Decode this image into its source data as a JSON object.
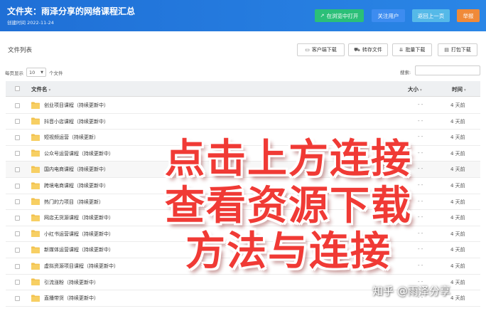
{
  "header": {
    "title": "文件夹：雨泽分享的网络课程汇总",
    "created": "创建时间 2022-11-24",
    "buttons": {
      "open_in_browser": "在浏览中打开",
      "follow_user": "关注用户",
      "back": "返回上一页",
      "report": "举报"
    }
  },
  "toolbar": {
    "title": "文件列表",
    "client_download": "客户端下载",
    "save": "转存文件",
    "batch_download": "批量下载",
    "pack_download": "打包下载"
  },
  "list_controls": {
    "per_page_label": "每页显示",
    "per_page_value": "10",
    "per_page_unit": "个文件",
    "search_label": "搜索:"
  },
  "table": {
    "columns": {
      "name": "文件名",
      "size": "大小",
      "time": "时间"
    },
    "rows": [
      {
        "name": "创业项目课程（持续更新中）",
        "size": "- -",
        "time": "4 天前"
      },
      {
        "name": "抖音小店课程（持续更新中）",
        "size": "- -",
        "time": "4 天前"
      },
      {
        "name": "短视频运营（持续更新）",
        "size": "- -",
        "time": "4 天前"
      },
      {
        "name": "公众号运营课程（持续更新中）",
        "size": "- -",
        "time": "4 天前"
      },
      {
        "name": "国内电商课程（持续更新中）",
        "size": "- -",
        "time": "4 天前"
      },
      {
        "name": "跨境电商课程（持续更新中）",
        "size": "- -",
        "time": "4 天前"
      },
      {
        "name": "热门的力项目（持续更新）",
        "size": "- -",
        "time": "4 天前"
      },
      {
        "name": "网店无货源课程（持续更新中）",
        "size": "- -",
        "time": "4 天前"
      },
      {
        "name": "小红书运营课程（持续更新中）",
        "size": "- -",
        "time": "4 天前"
      },
      {
        "name": "新媒体运营课程（持续更新中）",
        "size": "- -",
        "time": "4 天前"
      },
      {
        "name": "虚拟资源项目课程（持续更新中）",
        "size": "- -",
        "time": "4 天前"
      },
      {
        "name": "引流涨粉（持续更新中）",
        "size": "- -",
        "time": "4 天前"
      },
      {
        "name": "直播带货（持续更新中）",
        "size": "- -",
        "time": "4 天前"
      }
    ]
  },
  "overlay": {
    "line1": "点击上方连接",
    "line2": "查看资源下载",
    "line3": "方法与连接"
  },
  "watermark": "知乎 @雨泽分享",
  "colors": {
    "header_bg": "#1f6fd6",
    "open_button": "#2bbf78",
    "follow_button": "#3d8cf0",
    "back_button": "#55b9e8",
    "report_button": "#f08a39",
    "folder": "#f2c24f",
    "overlay_text": "#f03a35"
  },
  "icons": {
    "open": "external-link-icon",
    "client": "monitor-icon",
    "save": "car-transfer-icon",
    "batch": "batch-download-icon",
    "pack": "archive-icon",
    "folder": "folder-icon"
  }
}
